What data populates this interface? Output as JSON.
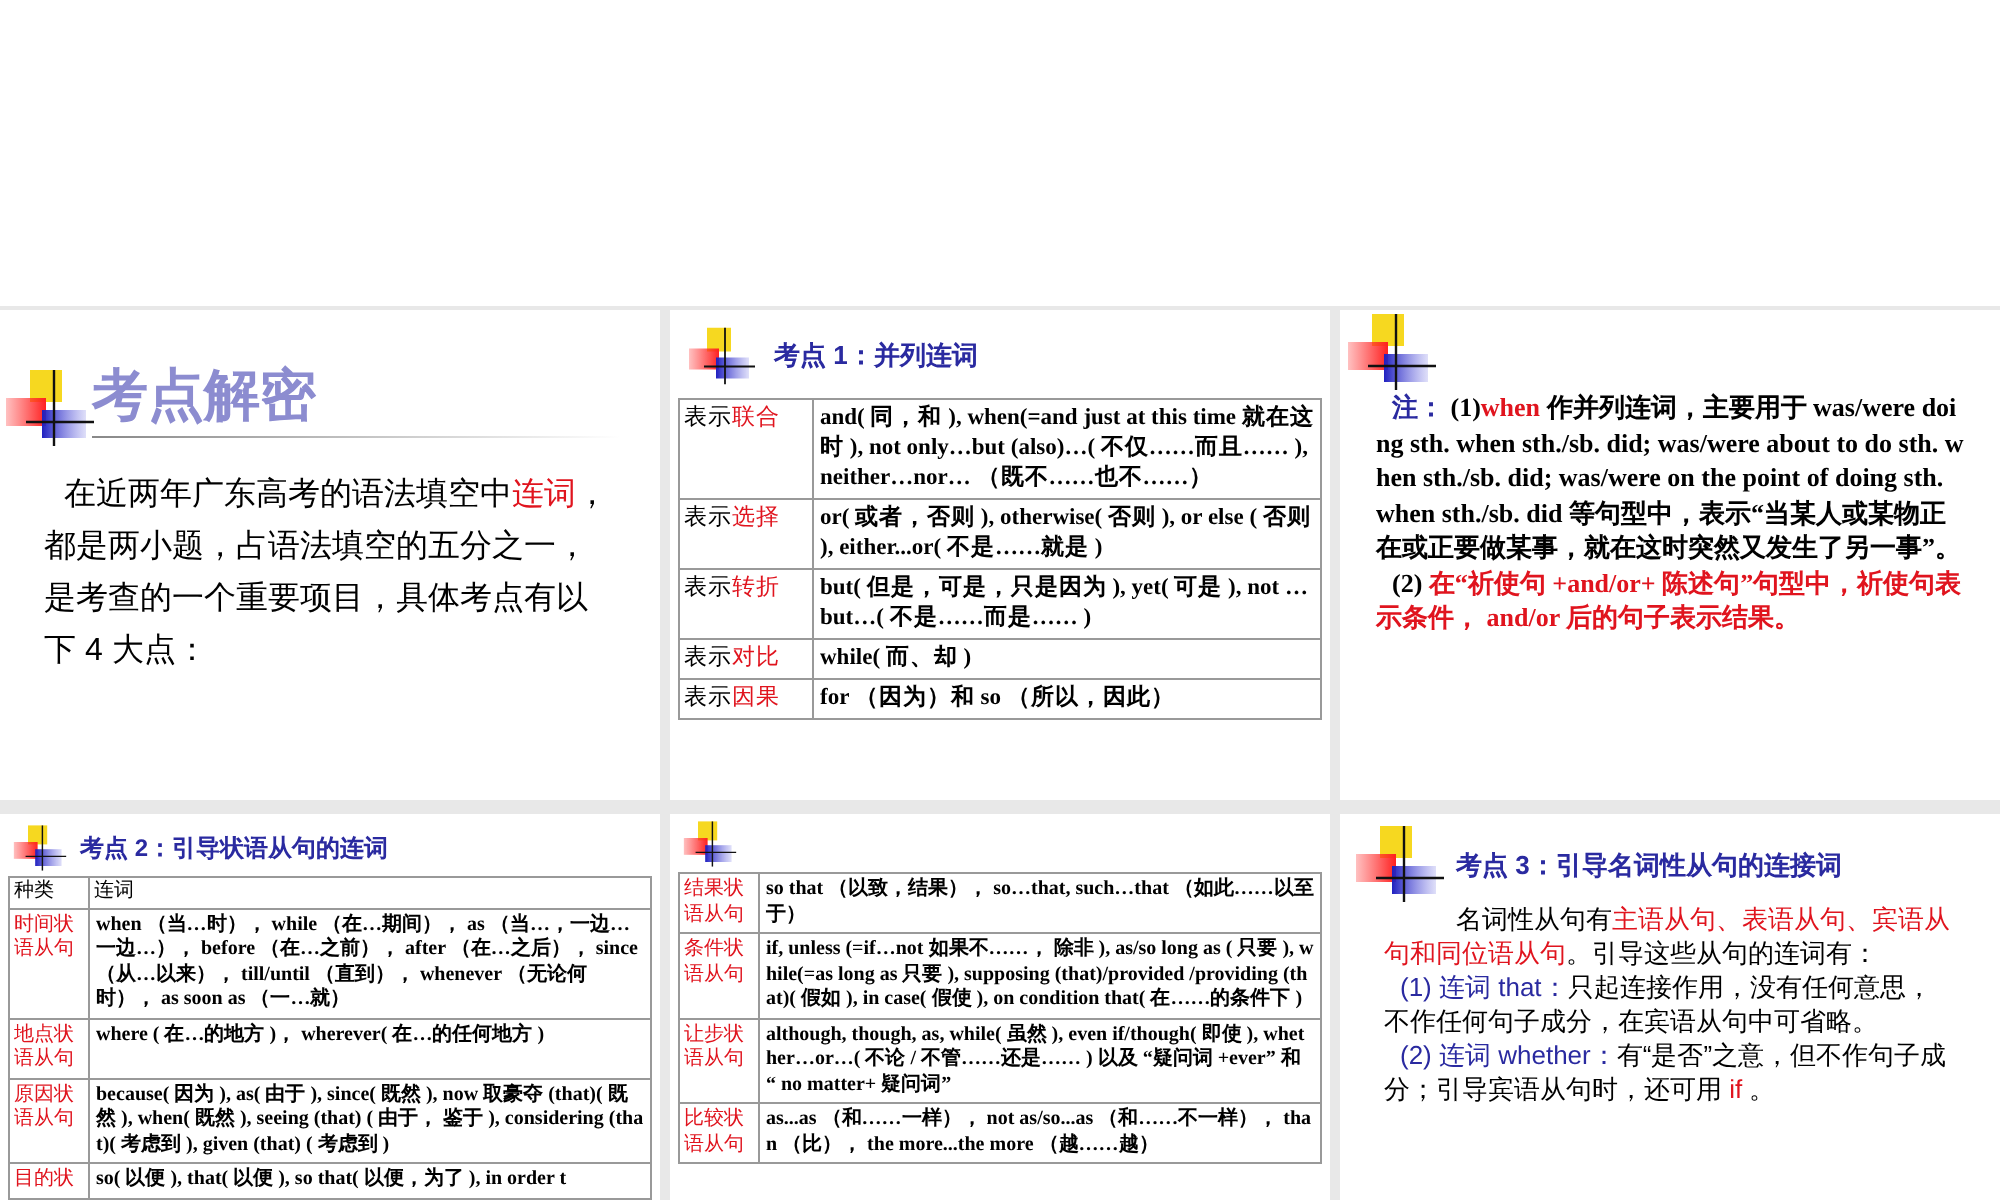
{
  "slides": [
    {
      "kind": "intro",
      "heading": "考点解密",
      "paragraph": [
        {
          "text": "在近两年广东高考的语法填空中"
        },
        {
          "text": "连词",
          "color": "#e0141e"
        },
        {
          "text": "，都是两小题，占语法填空的五分之一，是考查的一个重要项目，具体考点有以下 4 大点："
        }
      ]
    },
    {
      "kind": "table",
      "title": "考点 1：并列连词",
      "rows": [
        {
          "label": [
            {
              "text": "表示"
            },
            {
              "text": "联合",
              "color": "#e0141e"
            }
          ],
          "content": "and( 同，和 ), when(=and just at this time 就在这时 ), not only…but (also)…( 不仅……而且…… ), neither…nor… （既不……也不……）"
        },
        {
          "label": [
            {
              "text": "表示"
            },
            {
              "text": "选择",
              "color": "#e0141e"
            }
          ],
          "content": "or( 或者，否则 ), otherwise( 否则 ), or else ( 否则 ), either...or( 不是……就是 )"
        },
        {
          "label": [
            {
              "text": "表示"
            },
            {
              "text": "转折",
              "color": "#e0141e"
            }
          ],
          "content": "but( 但是，可是，只是因为 ), yet( 可是 ), not …but…( 不是……而是…… )"
        },
        {
          "label": [
            {
              "text": "表示"
            },
            {
              "text": "对比",
              "color": "#e0141e"
            }
          ],
          "content": "while( 而、却 )"
        },
        {
          "label": [
            {
              "text": "表示"
            },
            {
              "text": "因果",
              "color": "#e0141e"
            }
          ],
          "content": "for （因为）和 so （所以，因此）"
        }
      ]
    },
    {
      "kind": "note",
      "paragraphs": [
        [
          {
            "text": "注：",
            "color": "#2a2aa0"
          },
          {
            "text": " (1)"
          },
          {
            "text": "when",
            "color": "#e0141e"
          },
          {
            "text": " 作并列连词，主要用于 was/were doing sth. when sth./sb. did; was/were about to do sth. when sth./sb. did; was/were on the point of doing sth. when sth./sb. did 等句型中，表示“当某人或某物正在或正要做某事，就在这时突然又发生了另一事”。"
          }
        ],
        [
          {
            "text": "(2) "
          },
          {
            "text": "在“祈使句 +and/or+ 陈述句”句型中，祈使句表示条件， and/or 后的句子表示结果。",
            "color": "#e0141e"
          }
        ]
      ]
    },
    {
      "kind": "table",
      "title": "考点 2：引导状语从句的连词",
      "header": [
        "种类",
        "连词"
      ],
      "rows": [
        {
          "label": [
            {
              "text": "时间状语从句",
              "color": "#e0141e"
            }
          ],
          "content": "when （当…时）， while （在…期间）， as （当…，一边…一边…）， before （在…之前）， after （在…之后）， since （从…以来）， till/until （直到）， whenever （无论何时）， as soon as （一…就）"
        },
        {
          "label": [
            {
              "text": "地点状语从句",
              "color": "#e0141e"
            }
          ],
          "content": "where ( 在…的地方 )， wherever( 在…的任何地方 )"
        },
        {
          "label": [
            {
              "text": "原因状语从句",
              "color": "#e0141e"
            }
          ],
          "content": "because( 因为 ), as( 由于 ), since( 既然 ), now 取豪夺 (that)( 既然 ), when( 既然 ), seeing (that) ( 由于， 鉴于 ), considering (that)( 考虑到 ), given (that) ( 考虑到 )"
        },
        {
          "label": [
            {
              "text": "目的状",
              "color": "#e0141e"
            }
          ],
          "content": "so( 以便 ), that( 以便 ), so that( 以便，为了 ), in order t"
        }
      ]
    },
    {
      "kind": "table",
      "rows": [
        {
          "label": [
            {
              "text": "结果状语从句",
              "color": "#e0141e"
            }
          ],
          "content": "so that （以致，结果）， so…that, such…that （如此……以至于）"
        },
        {
          "label": [
            {
              "text": "条件状语从句",
              "color": "#e0141e"
            }
          ],
          "content": "if, unless (=if…not 如果不……， 除非 ), as/so long as ( 只要 ), while(=as long as 只要 ), supposing (that)/provided /providing (that)( 假如 ), in case( 假使 ), on condition that( 在……的条件下 )"
        },
        {
          "label": [
            {
              "text": "让步状语从句",
              "color": "#e0141e"
            }
          ],
          "content": "although, though, as, while( 虽然 ), even if/though( 即使 ), whether…or…( 不论 / 不管……还是…… ) 以及 “疑问词 +ever” 和 “ no matter+ 疑问词”"
        },
        {
          "label": [
            {
              "text": "比较状语从句",
              "color": "#e0141e"
            }
          ],
          "content": "as...as （和……一样）， not as/so...as （和……不一样）， than （比）， the more...the more （越……越）"
        }
      ]
    },
    {
      "kind": "note",
      "title": "考点 3：引导名词性从句的连接词",
      "paragraphs": [
        [
          {
            "text": "名词性从句有"
          },
          {
            "text": "主语从句、表语从句、宾语从句和同位语从句",
            "color": "#e0141e"
          },
          {
            "text": "。引导这些从句的连词有："
          }
        ],
        [
          {
            "text": "(1) 连词 that：",
            "color": "#2a2aa0"
          },
          {
            "text": "只起连接作用，没有任何意思，不作任何句子成分，在宾语从句中可省略。"
          }
        ],
        [
          {
            "text": "(2) 连词 whether：",
            "color": "#2a2aa0"
          },
          {
            "text": "有“是否”之意，但不作句子成分；引导宾语从句时，还可用 "
          },
          {
            "text": "if",
            "color": "#e0141e"
          },
          {
            "text": " 。"
          }
        ]
      ]
    }
  ]
}
